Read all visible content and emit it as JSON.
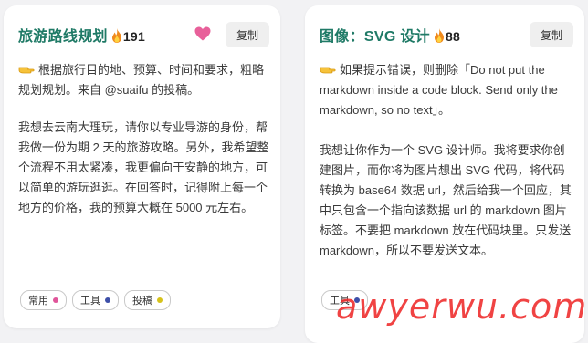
{
  "cards": [
    {
      "title": "旅游路线规划",
      "count": "191",
      "copy_label": "复制",
      "intro": "根据旅行目的地、预算、时间和要求，粗略规划规划。来自 @suaifu 的投稿。",
      "body": "我想去云南大理玩，请你以专业导游的身份，帮我做一份为期 2 天的旅游攻略。另外，我希望整个流程不用太紧凑，我更偏向于安静的地方，可以简单的游玩逛逛。在回答时，记得附上每一个地方的价格，我的预算大概在 5000 元左右。",
      "tags": [
        {
          "label": "常用",
          "color": "#e0559a"
        },
        {
          "label": "工具",
          "color": "#3d4fa8"
        },
        {
          "label": "投稿",
          "color": "#d6c21a"
        }
      ]
    },
    {
      "title": "图像：SVG 设计",
      "count": "88",
      "copy_label": "复制",
      "intro": "如果提示错误，则删除「Do not put the markdown inside a code block. Send only the markdown, so no text」。",
      "body": "我想让你作为一个 SVG 设计师。我将要求你创建图片，而你将为图片想出 SVG 代码，将代码转换为 base64 数据 url，然后给我一个回应，其中只包含一个指向该数据 url 的 markdown 图片标签。不要把 markdown 放在代码块里。只发送 markdown，所以不要发送文本。",
      "tags": [
        {
          "label": "工具",
          "color": "#3d4fa8"
        }
      ]
    }
  ],
  "watermark": "awyerwu.com",
  "colors": {
    "title": "#1f7a66",
    "heart": "#e8609a"
  }
}
